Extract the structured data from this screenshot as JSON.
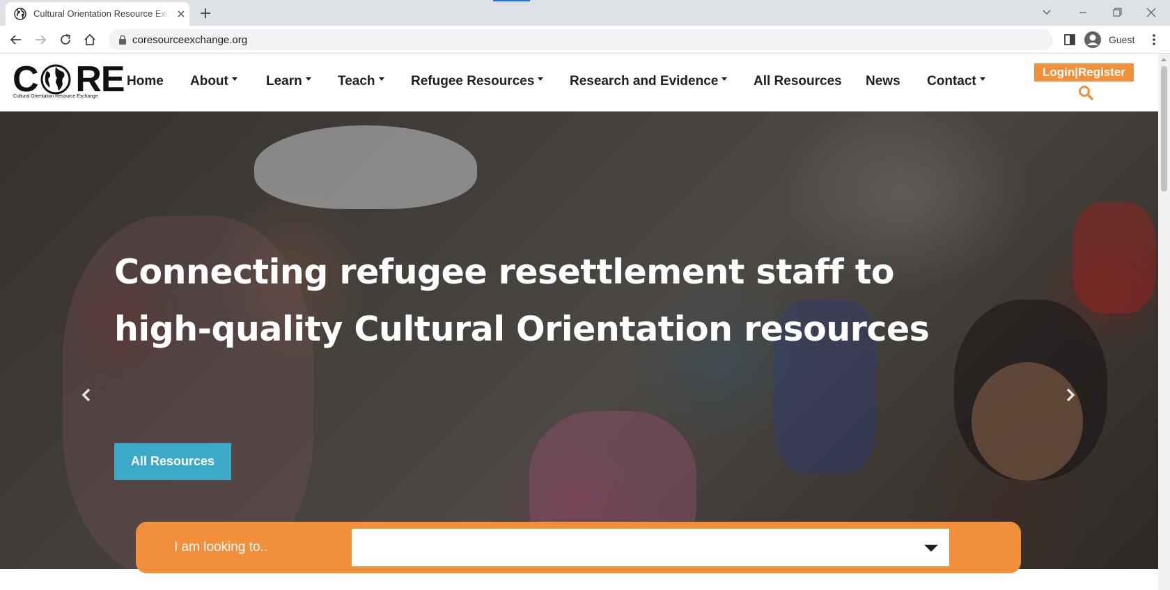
{
  "browser": {
    "tab_title": "Cultural Orientation Resource Exchange",
    "url": "coresourceexchange.org",
    "profile_name": "Guest"
  },
  "site": {
    "logo_text": "CORE",
    "logo_tagline": "Cultural Orientation Resource Exchange",
    "nav": [
      {
        "label": "Home",
        "dropdown": false
      },
      {
        "label": "About",
        "dropdown": true
      },
      {
        "label": "Learn",
        "dropdown": true
      },
      {
        "label": "Teach",
        "dropdown": true
      },
      {
        "label": "Refugee Resources",
        "dropdown": true
      },
      {
        "label": "Research and Evidence",
        "dropdown": true
      },
      {
        "label": "All Resources",
        "dropdown": false
      },
      {
        "label": "News",
        "dropdown": false
      },
      {
        "label": "Contact",
        "dropdown": true
      }
    ],
    "login_label": "Login|Register"
  },
  "hero": {
    "heading_line1": "Connecting refugee resettlement staff to",
    "heading_line2": "high-quality Cultural Orientation resources",
    "button_label": "All Resources"
  },
  "finder": {
    "label": "I am looking to..",
    "selected_value": ""
  },
  "colors": {
    "accent_orange": "#f28f3b",
    "button_teal": "#3ba9c7",
    "nav_text": "#1e1e1e"
  }
}
